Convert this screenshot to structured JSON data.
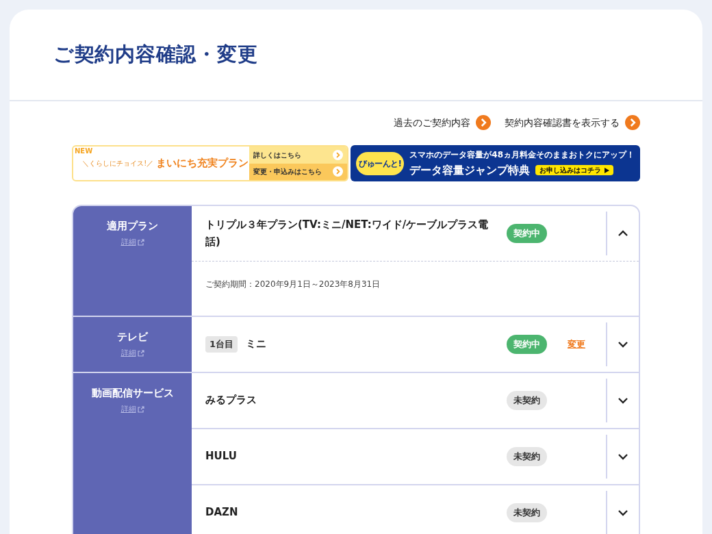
{
  "title": "ご契約内容確認・変更",
  "links": [
    {
      "label": "過去のご契約内容"
    },
    {
      "label": "契約内容確認書を表示する"
    }
  ],
  "banner_left": {
    "badge": "NEW",
    "tagline": "＼くらしにチョイス!／",
    "title": "まいにち充実プラン",
    "buttons": [
      "詳しくはこちら",
      "変更・申込みはこちら"
    ]
  },
  "banner_right": {
    "bubble": "びゅーんと!",
    "headline": "スマホのデータ容量が48ヵ月料金そのままおトクにアップ！",
    "title": "データ容量ジャンプ特典",
    "button": "お申し込みはコチラ"
  },
  "sections": [
    {
      "label": "適用プラン",
      "detail_link": "詳細",
      "rows": [
        {
          "name": "トリプル３年プラン(TV:ミニ/NET:ワイド/ケーブルプラス電話)",
          "status": {
            "label": "契約中",
            "kind": "active"
          },
          "expanded": true,
          "period": "ご契約期間：2020年9月1日～2023年8月31日"
        }
      ]
    },
    {
      "label": "テレビ",
      "detail_link": "詳細",
      "rows": [
        {
          "tag": "1台目",
          "name": "ミニ",
          "status": {
            "label": "契約中",
            "kind": "active"
          },
          "change_link": "変更",
          "expanded": false
        }
      ]
    },
    {
      "label": "動画配信サービス",
      "detail_link": "詳細",
      "rows": [
        {
          "name": "みるプラス",
          "status": {
            "label": "未契約",
            "kind": "inactive"
          },
          "expanded": false
        },
        {
          "name": "HULU",
          "status": {
            "label": "未契約",
            "kind": "inactive"
          },
          "expanded": false
        },
        {
          "name": "DAZN",
          "status": {
            "label": "未契約",
            "kind": "inactive"
          },
          "expanded": false
        }
      ]
    }
  ]
}
